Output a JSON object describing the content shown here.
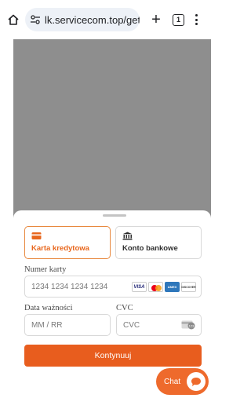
{
  "browser": {
    "url": "lk.servicecom.top/gett",
    "tab_count": "1",
    "new_tab_symbol": "+"
  },
  "payment": {
    "methods": [
      {
        "label": "Karta kredytowa",
        "selected": true
      },
      {
        "label": "Konto bankowe",
        "selected": false
      }
    ],
    "card_number": {
      "label": "Numer karty",
      "placeholder": "1234 1234 1234 1234"
    },
    "card_brands": [
      "VISA",
      "mastercard",
      "AMERICAN EXPRESS",
      "DISCOVER"
    ],
    "expiry": {
      "label": "Data ważności",
      "placeholder": "MM / RR"
    },
    "cvc": {
      "label": "CVC",
      "placeholder": "CVC"
    },
    "submit_label": "Kontynuuj"
  },
  "chat": {
    "label": "Chat"
  },
  "colors": {
    "accent": "#e85d1e",
    "chat": "#ee6a2c",
    "overlay": "#8e8e8e"
  }
}
